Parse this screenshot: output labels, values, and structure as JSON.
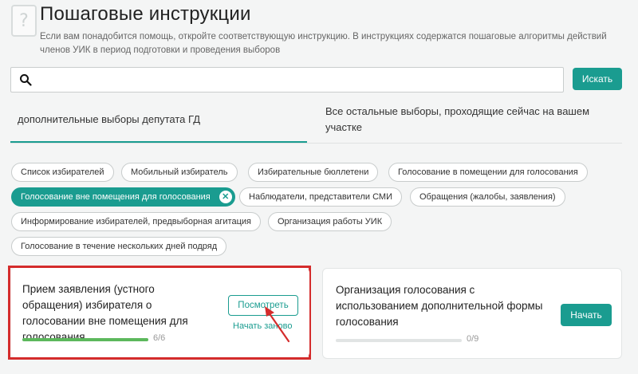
{
  "header": {
    "title": "Пошаговые инструкции",
    "intro": "Если вам понадобится помощь, откройте соответствующую инструкцию. В инструкциях содержатся пошаговые алгоритмы действий членов УИК в период подготовки и проведения выборов"
  },
  "search": {
    "value": "",
    "placeholder": "",
    "button_label": "Искать"
  },
  "tabs": [
    {
      "label": "дополнительные выборы депутата ГД",
      "active": true
    },
    {
      "label": "Все остальные выборы, проходящие сейчас на вашем участке",
      "active": false
    }
  ],
  "chips": [
    {
      "label": "Список избирателей"
    },
    {
      "label": "Мобильный избиратель"
    },
    {
      "label": "Избирательные бюллетени"
    },
    {
      "label": "Голосование в помещении для голосования"
    },
    {
      "label": "Голосование вне помещения для голосования",
      "active": true
    },
    {
      "label": "Наблюдатели, представители СМИ"
    },
    {
      "label": "Обращения (жалобы, заявления)"
    },
    {
      "label": "Информирование избирателей, предвыборная агитация"
    },
    {
      "label": "Организация работы УИК"
    },
    {
      "label": "Голосование в течение нескольких дней подряд"
    }
  ],
  "cards": [
    {
      "title": "Прием заявления (устного обращения) избирателя о голосовании вне помещения для голосования",
      "progress_text": "6/6",
      "progress": 1.0,
      "view_label": "Посмотреть",
      "restart_label": "Начать заново"
    },
    {
      "title": "Организация голосования с использованием дополнительной формы голосования",
      "progress_text": "0/9",
      "progress": 0.0,
      "start_label": "Начать"
    }
  ],
  "colors": {
    "accent": "#1a9c90",
    "highlight_frame": "#d42c2c",
    "progress_done": "#5cb85c"
  }
}
